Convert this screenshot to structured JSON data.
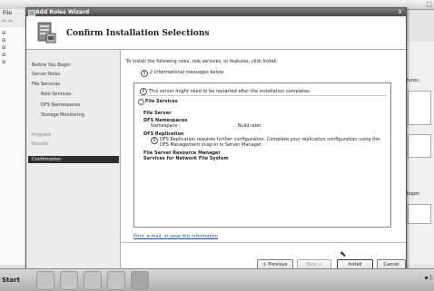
{
  "background_window": {
    "menu_file": "File",
    "nav_arrows": "⇦ ⇨",
    "right_text_1": "tures.",
    "right_text_2": "logon",
    "maximize_glyph": "□"
  },
  "dialog": {
    "title": "Add Roles Wizard",
    "close_glyph": "X",
    "header_title": "Confirm Installation Selections",
    "nav": {
      "before_you_begin": "Before You Begin",
      "server_roles": "Server Roles",
      "file_services": "File Services",
      "role_services": "Role Services",
      "dfs_namespaces": "DFS Namespaces",
      "storage_monitoring": "Storage Monitoring",
      "confirmation": "Confirmation",
      "progress": "Progress",
      "results": "Results"
    },
    "intro": "To install the following roles, role services, or features, click Install.",
    "info_count": "2 informational messages below",
    "results": {
      "restart_warning": "This server might need to be restarted after the installation completes.",
      "section": "File Services",
      "file_server": "File Server",
      "dfs_namespaces": "DFS Namespaces",
      "namespace_label": "Namespace :",
      "namespace_value": "Build later",
      "dfs_replication": "DFS Replication",
      "replication_note_1": "DFS Replication requires further configuration. Complete your replication configuration using the",
      "replication_note_2": "DFS Management snap-in in Server Manager.",
      "file_server_rm": "File Server Resource Manager",
      "services_nfs": "Services for Network File System"
    },
    "save_link": "Print, e-mail, or save this information",
    "buttons": {
      "previous": "< Previous",
      "next": "Next >",
      "install": "Install",
      "cancel": "Cancel"
    }
  },
  "taskbar": {
    "start": "Start",
    "tray": "▪ ["
  }
}
